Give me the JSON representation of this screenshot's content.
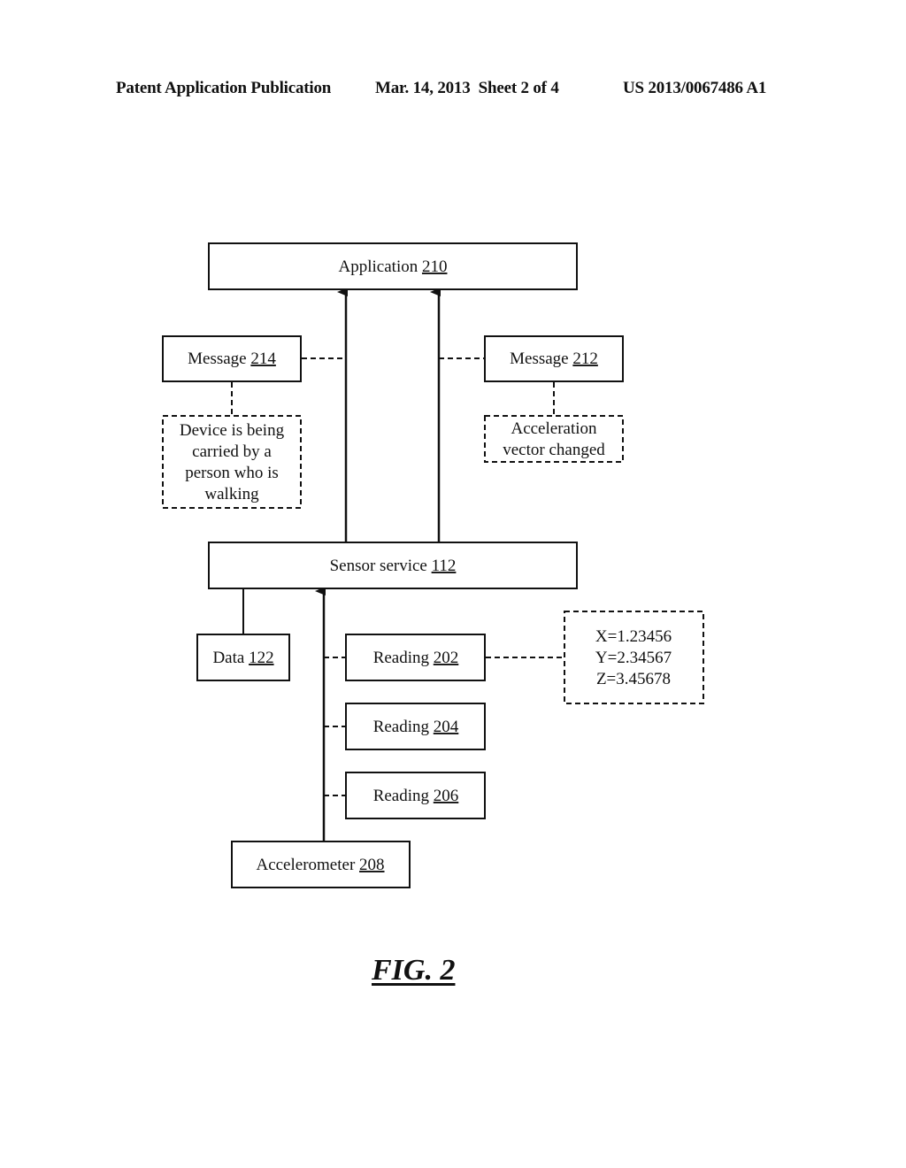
{
  "header": {
    "publication": "Patent Application Publication",
    "date_sheet": "Mar. 14, 2013  Sheet 2 of 4",
    "patent_number": "US 2013/0067486 A1"
  },
  "diagram": {
    "application": {
      "label": "Application",
      "ref": "210"
    },
    "message_214": {
      "label": "Message",
      "ref": "214"
    },
    "message_212": {
      "label": "Message",
      "ref": "212"
    },
    "note_214": {
      "lines": [
        "Device is being",
        "carried by a",
        "person who is",
        "walking"
      ]
    },
    "note_212": {
      "lines": [
        "Acceleration",
        "vector changed"
      ]
    },
    "sensor_service": {
      "label": "Sensor service",
      "ref": "112"
    },
    "data": {
      "label": "Data",
      "ref": "122"
    },
    "reading_202": {
      "label": "Reading",
      "ref": "202"
    },
    "reading_204": {
      "label": "Reading",
      "ref": "204"
    },
    "reading_206": {
      "label": "Reading",
      "ref": "206"
    },
    "reading_values": {
      "lines": [
        "X=1.23456",
        "Y=2.34567",
        "Z=3.45678"
      ]
    },
    "accelerometer": {
      "label": "Accelerometer",
      "ref": "208"
    }
  },
  "figure_label": "FIG. 2"
}
